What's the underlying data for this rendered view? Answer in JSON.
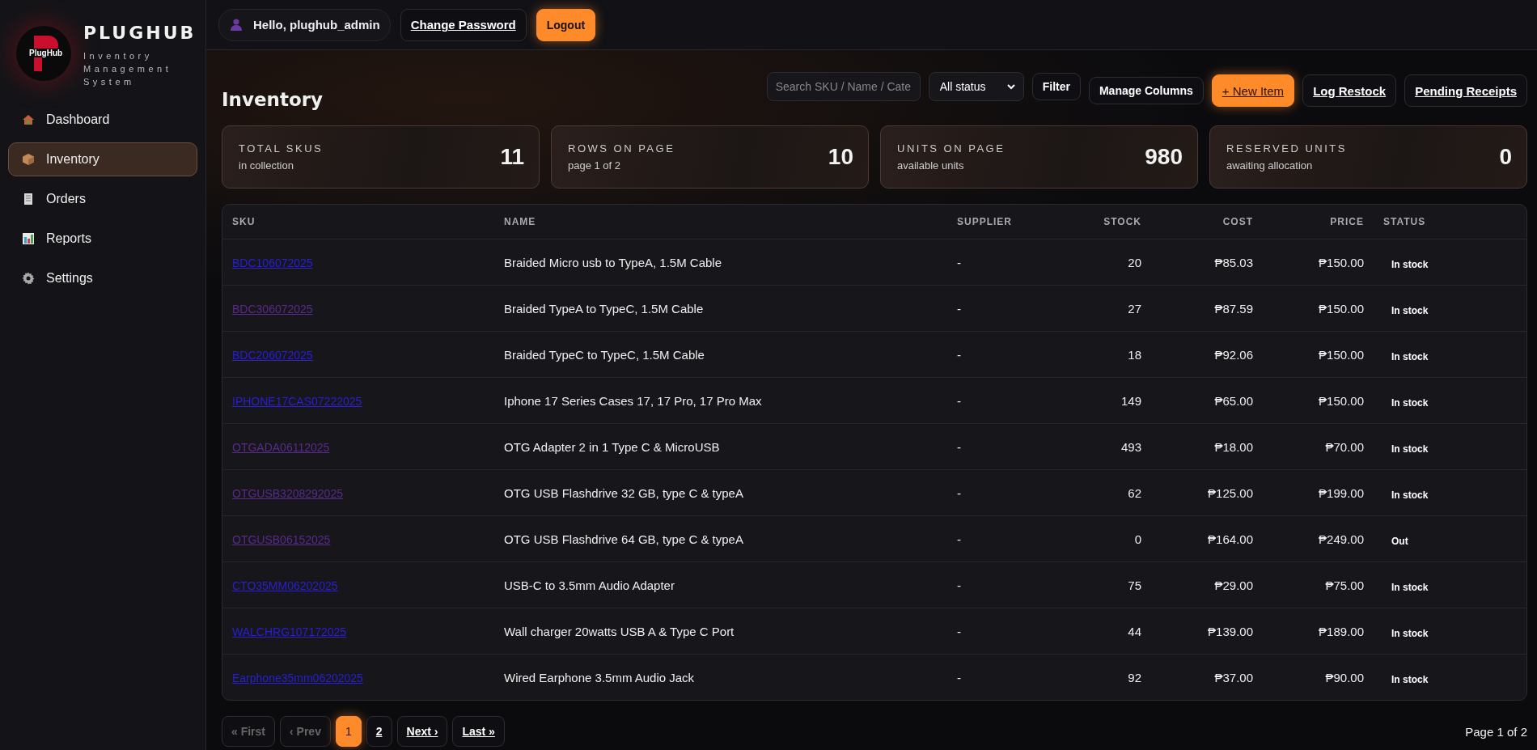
{
  "sidebar": {
    "brand": {
      "logo_text": "PlugHub",
      "title": "PLUGHUB",
      "subtitle": "Inventory Management System"
    },
    "nav": [
      {
        "label": "Dashboard",
        "kind": "house",
        "selected": false
      },
      {
        "label": "Inventory",
        "kind": "box",
        "selected": true
      },
      {
        "label": "Orders",
        "kind": "receipt",
        "selected": false
      },
      {
        "label": "Reports",
        "kind": "chart",
        "selected": false
      },
      {
        "label": "Settings",
        "kind": "gear",
        "selected": false
      }
    ]
  },
  "topbar": {
    "greeting": "Hello, plughub_admin",
    "actions": [
      {
        "label": "Change Password",
        "kind": "link"
      },
      {
        "label": "Logout",
        "kind": "primary"
      }
    ]
  },
  "page": {
    "title": "Inventory",
    "search": {
      "placeholder": "Search SKU / Name / Cate"
    },
    "status_filter": {
      "value": "All status"
    },
    "actions": [
      {
        "label": "Filter",
        "kind": "plain"
      },
      {
        "label": "Manage Columns",
        "kind": "plain"
      },
      {
        "label": "+ New Item",
        "kind": "primary"
      },
      {
        "label": "Log Restock",
        "kind": "link"
      },
      {
        "label": "Pending Receipts",
        "kind": "link"
      }
    ]
  },
  "stats": [
    {
      "label": "TOTAL SKUS",
      "sub": "in collection",
      "value": "11"
    },
    {
      "label": "ROWS ON PAGE",
      "sub": "page 1 of 2",
      "value": "10"
    },
    {
      "label": "UNITS ON PAGE",
      "sub": "available units",
      "value": "980"
    },
    {
      "label": "RESERVED UNITS",
      "sub": "awaiting allocation",
      "value": "0"
    }
  ],
  "table": {
    "columns": [
      "SKU",
      "NAME",
      "SUPPLIER",
      "STOCK",
      "COST",
      "PRICE",
      "STATUS"
    ],
    "rows": [
      {
        "sku": "BDC106072025",
        "visited": false,
        "name": "Braided Micro usb to TypeA, 1.5M Cable",
        "supplier": "-",
        "stock": "20",
        "cost": "₱85.03",
        "price": "₱150.00",
        "status": "In stock"
      },
      {
        "sku": "BDC306072025",
        "visited": true,
        "name": "Braided TypeA to TypeC, 1.5M Cable",
        "supplier": "-",
        "stock": "27",
        "cost": "₱87.59",
        "price": "₱150.00",
        "status": "In stock"
      },
      {
        "sku": "BDC206072025",
        "visited": false,
        "name": "Braided TypeC to TypeC, 1.5M Cable",
        "supplier": "-",
        "stock": "18",
        "cost": "₱92.06",
        "price": "₱150.00",
        "status": "In stock"
      },
      {
        "sku": "IPHONE17CAS07222025",
        "visited": false,
        "name": "Iphone 17 Series Cases 17, 17 Pro, 17 Pro Max",
        "supplier": "-",
        "stock": "149",
        "cost": "₱65.00",
        "price": "₱150.00",
        "status": "In stock"
      },
      {
        "sku": "OTGADA06112025",
        "visited": true,
        "name": "OTG Adapter 2 in 1 Type C & MicroUSB",
        "supplier": "-",
        "stock": "493",
        "cost": "₱18.00",
        "price": "₱70.00",
        "status": "In stock"
      },
      {
        "sku": "OTGUSB3208292025",
        "visited": true,
        "name": "OTG USB Flashdrive 32 GB, type C & typeA",
        "supplier": "-",
        "stock": "62",
        "cost": "₱125.00",
        "price": "₱199.00",
        "status": "In stock"
      },
      {
        "sku": "OTGUSB06152025",
        "visited": true,
        "name": "OTG USB Flashdrive 64 GB, type C & typeA",
        "supplier": "-",
        "stock": "0",
        "cost": "₱164.00",
        "price": "₱249.00",
        "status": "Out"
      },
      {
        "sku": "CTO35MM06202025",
        "visited": false,
        "name": "USB-C to 3.5mm Audio Adapter",
        "supplier": "-",
        "stock": "75",
        "cost": "₱29.00",
        "price": "₱75.00",
        "status": "In stock"
      },
      {
        "sku": "WALCHRG107172025",
        "visited": false,
        "name": "Wall charger 20watts USB A & Type C Port",
        "supplier": "-",
        "stock": "44",
        "cost": "₱139.00",
        "price": "₱189.00",
        "status": "In stock"
      },
      {
        "sku": "Earphone35mm06202025",
        "visited": false,
        "name": "Wired Earphone 3.5mm Audio Jack",
        "supplier": "-",
        "stock": "92",
        "cost": "₱37.00",
        "price": "₱90.00",
        "status": "In stock"
      }
    ]
  },
  "pagination": {
    "buttons": [
      {
        "label": "« First",
        "disabled": true,
        "selected": false
      },
      {
        "label": "‹ Prev",
        "disabled": true,
        "selected": false
      },
      {
        "label": "1",
        "disabled": false,
        "selected": true
      },
      {
        "label": "2",
        "disabled": false,
        "selected": false
      },
      {
        "label": "Next ›",
        "disabled": false,
        "selected": false
      },
      {
        "label": "Last »",
        "disabled": false,
        "selected": false
      }
    ],
    "summary": "Page 1 of 2"
  }
}
